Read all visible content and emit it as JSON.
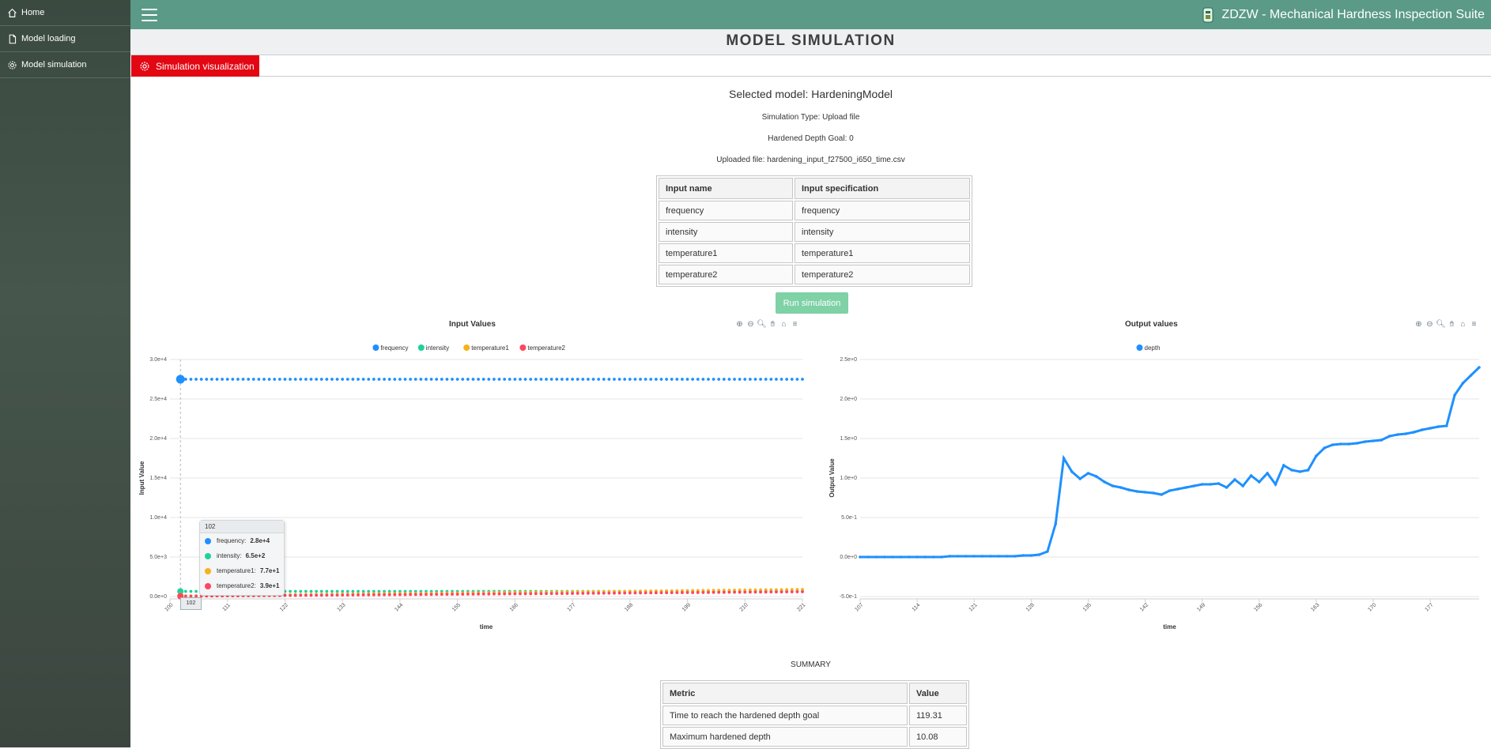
{
  "sidebar": {
    "items": [
      {
        "label": "Home",
        "icon": "home-icon"
      },
      {
        "label": "Model loading",
        "icon": "file-icon"
      },
      {
        "label": "Model simulation",
        "icon": "gear-icon"
      }
    ]
  },
  "topbar": {
    "app_title": "ZDZW - Mechanical Hardness Inspection Suite"
  },
  "page": {
    "title": "MODEL SIMULATION"
  },
  "tab": {
    "label": "Simulation visualization"
  },
  "info": {
    "selected_model": "Selected model: HardeningModel",
    "simulation_type": "Simulation Type: Upload file",
    "depth_goal": "Hardened Depth Goal: 0",
    "uploaded_file": "Uploaded file: hardening_input_f27500_i650_time.csv"
  },
  "inputs_table": {
    "headers": [
      "Input name",
      "Input specification"
    ],
    "rows": [
      [
        "frequency",
        "frequency"
      ],
      [
        "intensity",
        "intensity"
      ],
      [
        "temperature1",
        "temperature1"
      ],
      [
        "temperature2",
        "temperature2"
      ]
    ]
  },
  "run_button": "Run simulation",
  "colors": {
    "frequency": "#1e90ff",
    "intensity": "#1fd19a",
    "temperature1": "#f6b21b",
    "temperature2": "#ff4560",
    "depth": "#1e90ff",
    "header": "#5a9a86",
    "tab": "#e30613"
  },
  "chart_data": [
    {
      "type": "line",
      "title": "Input Values",
      "xlabel": "time",
      "ylabel": "Input Value",
      "legend_position": "top-center",
      "x_ticks": [
        "100",
        "111",
        "122",
        "133",
        "144",
        "155",
        "166",
        "177",
        "188",
        "199",
        "210",
        "221"
      ],
      "y_ticks": [
        "0.0e+0",
        "5.0e+3",
        "1.0e+4",
        "1.5e+4",
        "2.0e+4",
        "2.5e+4",
        "3.0e+4"
      ],
      "xlim": [
        100,
        221
      ],
      "ylim": [
        0,
        30000
      ],
      "series": [
        {
          "name": "frequency",
          "constant": 27500
        },
        {
          "name": "intensity",
          "start": 650,
          "end": 650
        },
        {
          "name": "temperature1",
          "start": 77,
          "end": 900
        },
        {
          "name": "temperature2",
          "start": 39,
          "end": 600
        }
      ],
      "tooltip": {
        "x": "102",
        "rows": [
          {
            "name": "frequency:",
            "value": "2.8e+4"
          },
          {
            "name": "intensity:",
            "value": "6.5e+2"
          },
          {
            "name": "temperature1:",
            "value": "7.7e+1"
          },
          {
            "name": "temperature2:",
            "value": "3.9e+1"
          }
        ]
      }
    },
    {
      "type": "line",
      "title": "Output values",
      "xlabel": "time",
      "ylabel": "Output Value",
      "legend_position": "top-center",
      "x_ticks": [
        "107",
        "114",
        "121",
        "128",
        "135",
        "142",
        "149",
        "156",
        "163",
        "170",
        "177"
      ],
      "y_ticks": [
        "-5.0e-1",
        "0.0e+0",
        "5.0e-1",
        "1.0e+0",
        "1.5e+0",
        "2.0e+0",
        "2.5e+0"
      ],
      "xlim": [
        107,
        183
      ],
      "ylim": [
        -0.5,
        2.5
      ],
      "series": [
        {
          "name": "depth",
          "x": [
            107,
            108,
            109,
            110,
            111,
            112,
            113,
            114,
            115,
            116,
            117,
            118,
            119,
            120,
            121,
            122,
            123,
            124,
            125,
            126,
            127,
            128,
            129,
            130,
            131,
            132,
            133,
            134,
            135,
            136,
            137,
            138,
            139,
            140,
            141,
            142,
            143,
            144,
            145,
            146,
            147,
            148,
            149,
            150,
            151,
            152,
            153,
            154,
            155,
            156,
            157,
            158,
            159,
            160,
            161,
            162,
            163,
            164,
            165,
            166,
            167,
            168,
            169,
            170,
            171,
            172,
            173,
            174,
            175,
            176,
            177,
            178,
            179,
            180,
            181,
            182,
            183
          ],
          "y": [
            0,
            0,
            0,
            0,
            0,
            0,
            0,
            0,
            0,
            0,
            0,
            0.01,
            0.01,
            0.01,
            0.01,
            0.01,
            0.01,
            0.01,
            0.01,
            0.01,
            0.02,
            0.02,
            0.03,
            0.07,
            0.42,
            1.25,
            1.08,
            0.99,
            1.06,
            1.02,
            0.95,
            0.9,
            0.88,
            0.85,
            0.83,
            0.82,
            0.81,
            0.79,
            0.84,
            0.86,
            0.88,
            0.9,
            0.92,
            0.92,
            0.93,
            0.88,
            0.98,
            0.9,
            1.03,
            0.95,
            1.06,
            0.92,
            1.16,
            1.1,
            1.08,
            1.1,
            1.28,
            1.38,
            1.42,
            1.43,
            1.43,
            1.44,
            1.46,
            1.47,
            1.48,
            1.53,
            1.55,
            1.56,
            1.58,
            1.61,
            1.63,
            1.65,
            1.66,
            2.05,
            2.2,
            2.3,
            2.4
          ]
        }
      ]
    }
  ],
  "summary": {
    "title": "SUMMARY",
    "headers": [
      "Metric",
      "Value"
    ],
    "rows": [
      [
        "Time to reach the hardened depth goal",
        "119.31"
      ],
      [
        "Maximum hardened depth",
        "10.08"
      ]
    ]
  }
}
